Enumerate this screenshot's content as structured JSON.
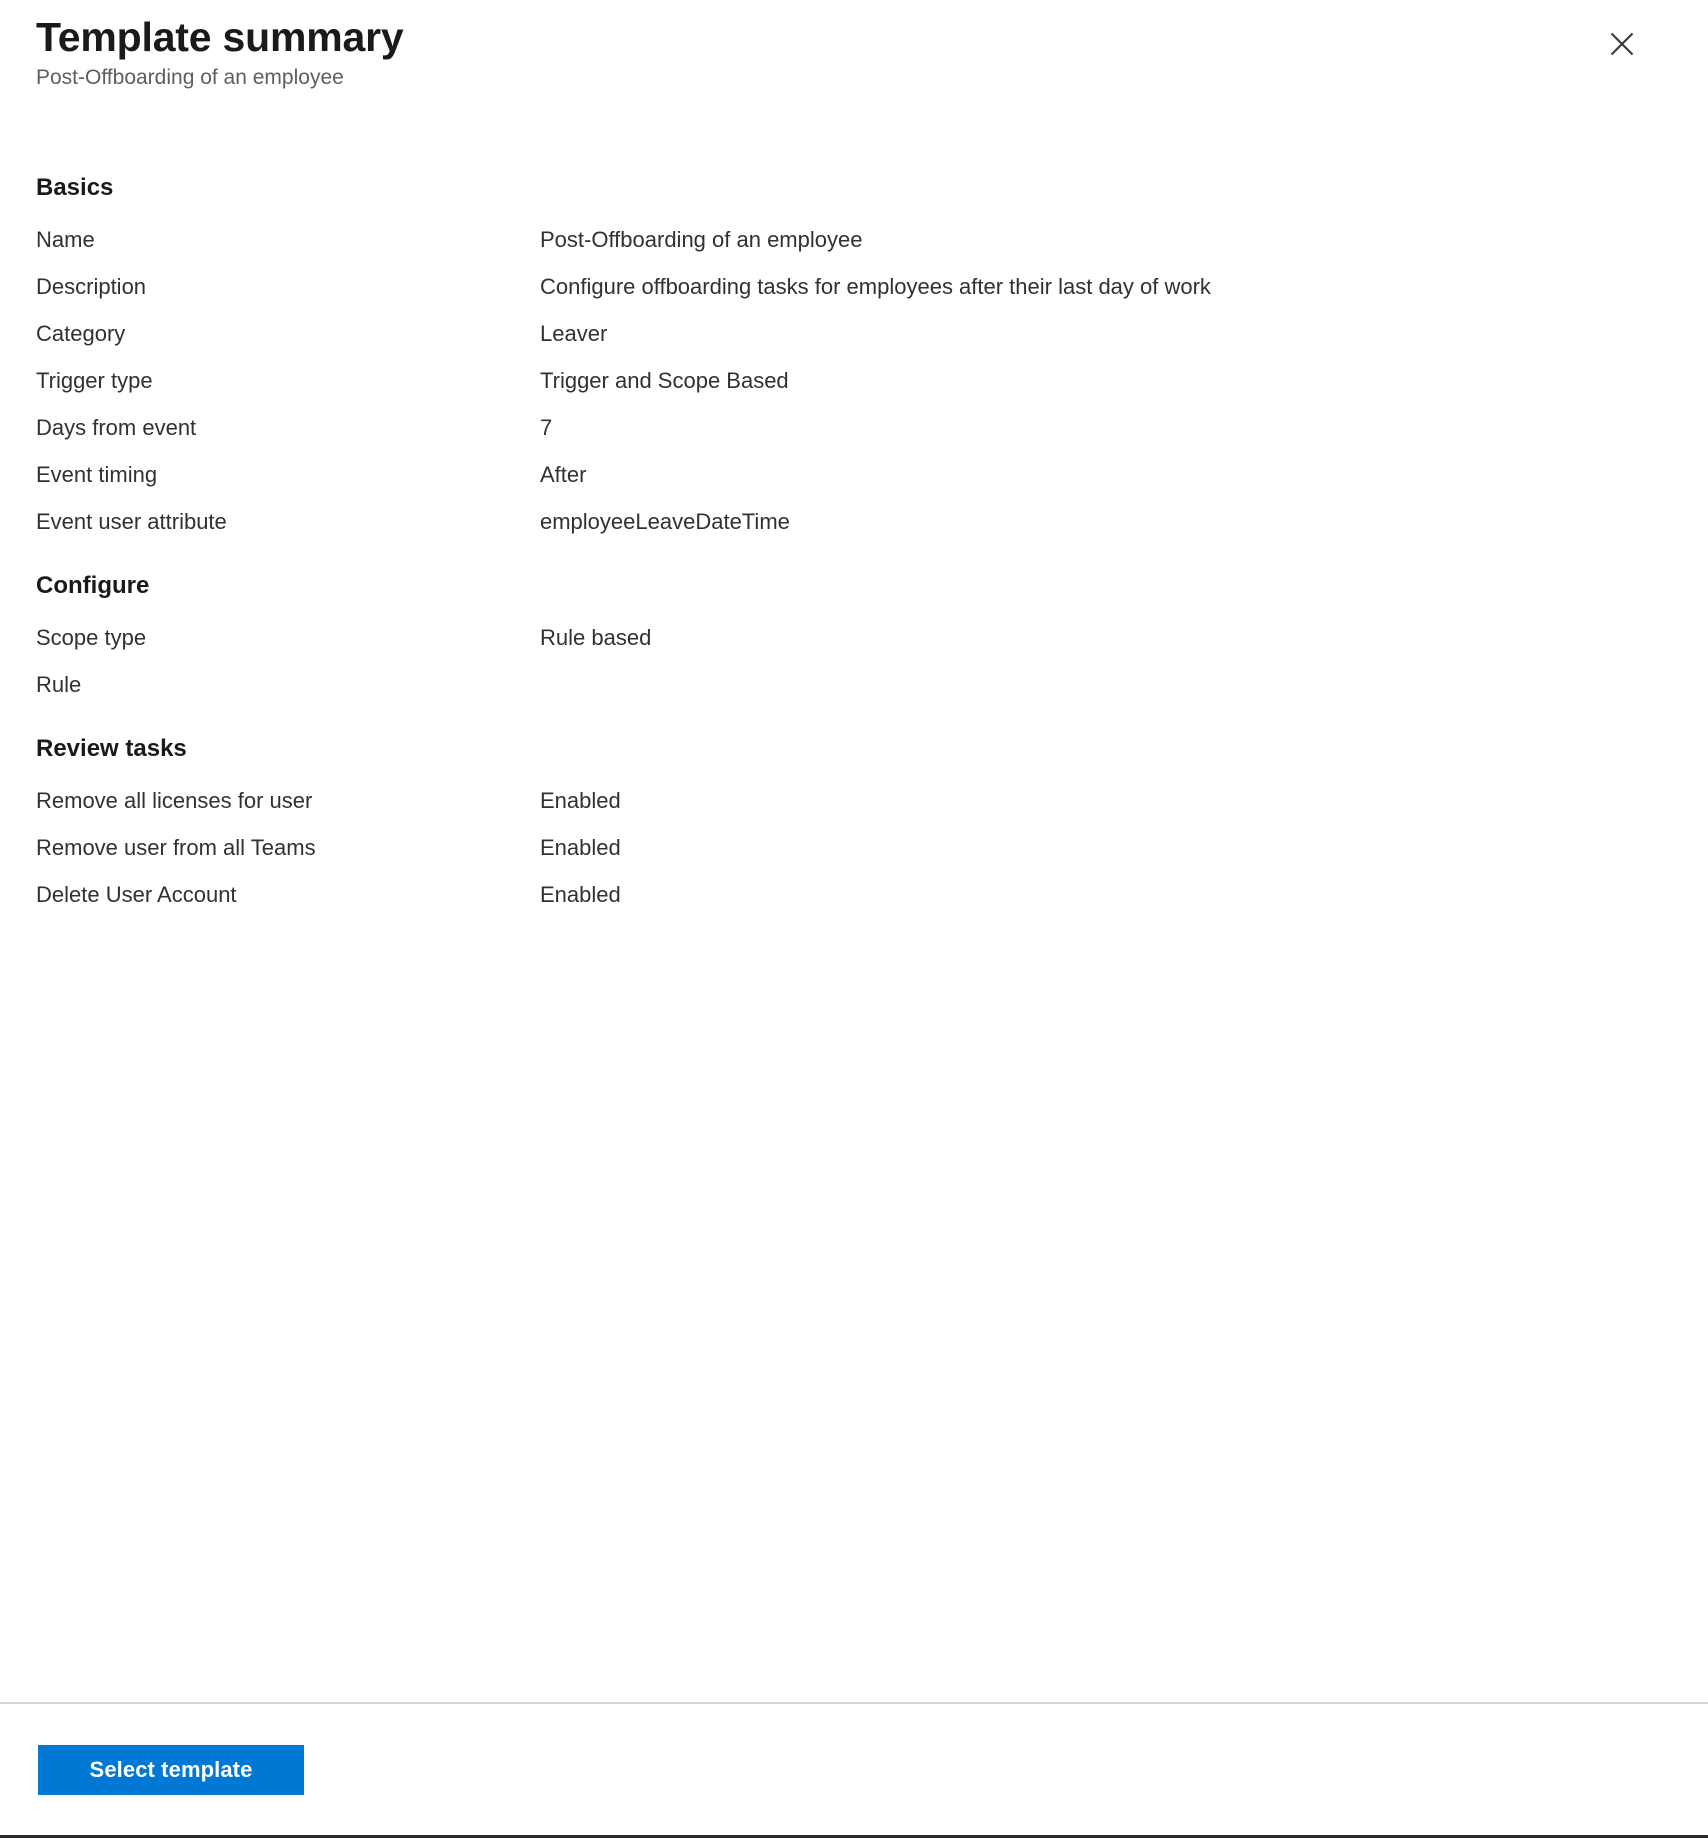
{
  "header": {
    "title": "Template summary",
    "subtitle": "Post-Offboarding of an employee",
    "close_icon": "close-icon",
    "close_label": "Close"
  },
  "sections": [
    {
      "id": "basics",
      "title": "Basics",
      "rows": [
        {
          "label": "Name",
          "value": "Post-Offboarding of an employee"
        },
        {
          "label": "Description",
          "value": "Configure offboarding tasks for employees after their last day of work"
        },
        {
          "label": "Category",
          "value": "Leaver"
        },
        {
          "label": "Trigger type",
          "value": "Trigger and Scope Based"
        },
        {
          "label": "Days from event",
          "value": "7"
        },
        {
          "label": "Event timing",
          "value": "After"
        },
        {
          "label": "Event user attribute",
          "value": "employeeLeaveDateTime"
        }
      ]
    },
    {
      "id": "configure",
      "title": "Configure",
      "rows": [
        {
          "label": "Scope type",
          "value": "Rule based"
        },
        {
          "label": "Rule",
          "value": ""
        }
      ]
    },
    {
      "id": "review-tasks",
      "title": "Review tasks",
      "rows": [
        {
          "label": "Remove all licenses for user",
          "value": "Enabled"
        },
        {
          "label": "Remove user from all Teams",
          "value": "Enabled"
        },
        {
          "label": "Delete User Account",
          "value": "Enabled"
        }
      ]
    }
  ],
  "footer": {
    "primary_button_label": "Select template"
  },
  "colors": {
    "accent": "#0078d4",
    "text": "#323130",
    "heading": "#1b1a19",
    "subtle_text": "#605e5c",
    "divider": "#d6d4d2",
    "background": "#ffffff"
  }
}
